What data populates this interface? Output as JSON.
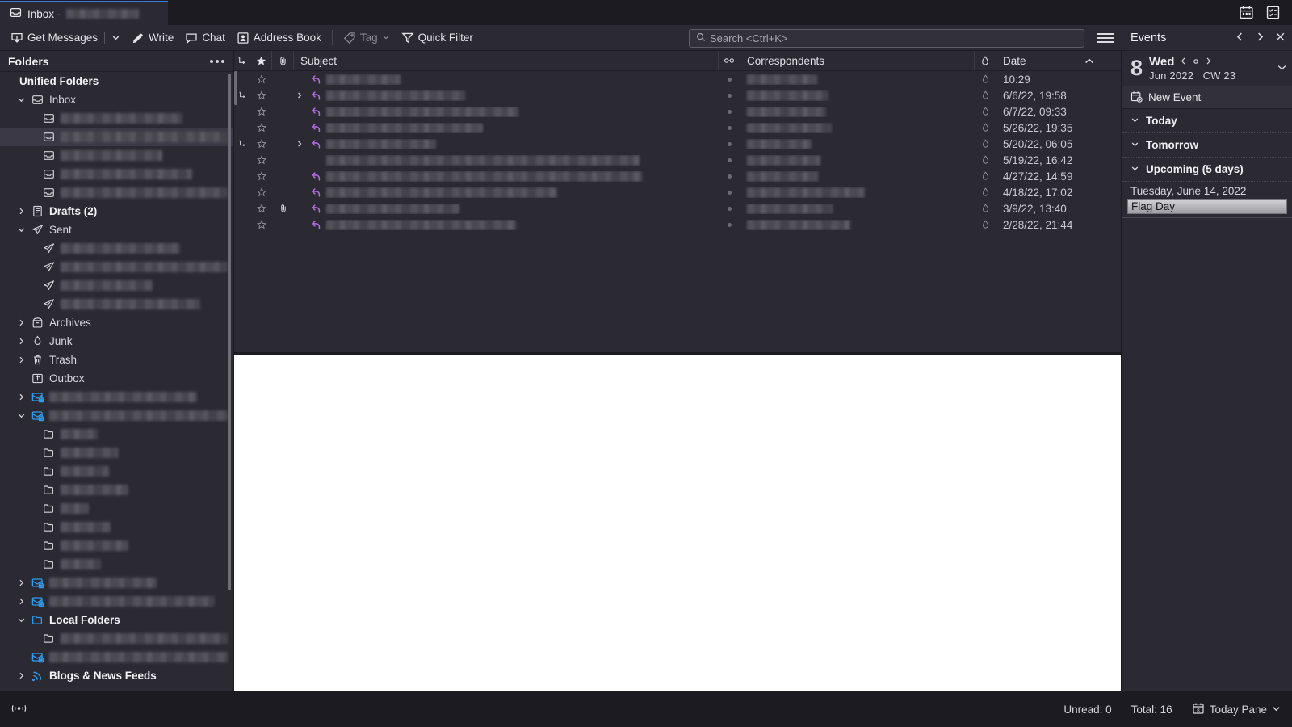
{
  "window": {
    "tab_title": "Inbox -",
    "tab_redacted_width": 90,
    "titlebar_icons": [
      "calendar-icon",
      "tasks-icon"
    ]
  },
  "toolbar": {
    "get_messages": "Get Messages",
    "write": "Write",
    "chat": "Chat",
    "address_book": "Address Book",
    "tag": "Tag",
    "quick_filter": "Quick Filter"
  },
  "search": {
    "placeholder": "Search <Ctrl+K>",
    "value": ""
  },
  "folder_pane": {
    "title": "Folders",
    "items": [
      {
        "label": "Unified Folders",
        "indent": 0,
        "twisty": "none",
        "icon": "none",
        "bold": true,
        "redacted": 0,
        "selected": false
      },
      {
        "label": "Inbox",
        "indent": 1,
        "twisty": "down",
        "icon": "inbox-icon",
        "bold": false,
        "redacted": 0,
        "selected": false
      },
      {
        "label": "",
        "indent": 2,
        "twisty": "none",
        "icon": "inbox-icon",
        "bold": false,
        "redacted": 151,
        "selected": false
      },
      {
        "label": "",
        "indent": 2,
        "twisty": "none",
        "icon": "inbox-icon",
        "bold": false,
        "redacted": 212,
        "selected": true
      },
      {
        "label": "",
        "indent": 2,
        "twisty": "none",
        "icon": "inbox-icon",
        "bold": false,
        "redacted": 126,
        "selected": false
      },
      {
        "label": "",
        "indent": 2,
        "twisty": "none",
        "icon": "inbox-icon",
        "bold": false,
        "redacted": 163,
        "selected": false
      },
      {
        "label": "",
        "indent": 2,
        "twisty": "none",
        "icon": "inbox-icon",
        "bold": false,
        "redacted": 212,
        "selected": false
      },
      {
        "label": "Drafts (2)",
        "indent": 1,
        "twisty": "right",
        "icon": "drafts-icon",
        "bold": true,
        "redacted": 0,
        "selected": false
      },
      {
        "label": "Sent",
        "indent": 1,
        "twisty": "down",
        "icon": "sent-icon",
        "bold": false,
        "redacted": 0,
        "selected": false
      },
      {
        "label": "",
        "indent": 2,
        "twisty": "none",
        "icon": "sent-icon",
        "bold": false,
        "redacted": 148,
        "selected": false
      },
      {
        "label": "",
        "indent": 2,
        "twisty": "none",
        "icon": "sent-icon",
        "bold": false,
        "redacted": 212,
        "selected": false
      },
      {
        "label": "",
        "indent": 2,
        "twisty": "none",
        "icon": "sent-icon",
        "bold": false,
        "redacted": 114,
        "selected": false
      },
      {
        "label": "",
        "indent": 2,
        "twisty": "none",
        "icon": "sent-icon",
        "bold": false,
        "redacted": 173,
        "selected": false
      },
      {
        "label": "Archives",
        "indent": 1,
        "twisty": "right",
        "icon": "archive-icon",
        "bold": false,
        "redacted": 0,
        "selected": false
      },
      {
        "label": "Junk",
        "indent": 1,
        "twisty": "right",
        "icon": "junk-icon",
        "bold": false,
        "redacted": 0,
        "selected": false
      },
      {
        "label": "Trash",
        "indent": 1,
        "twisty": "right",
        "icon": "trash-icon",
        "bold": false,
        "redacted": 0,
        "selected": false
      },
      {
        "label": "Outbox",
        "indent": 1,
        "twisty": "none",
        "icon": "outbox-icon",
        "bold": false,
        "redacted": 0,
        "selected": false
      },
      {
        "label": "",
        "indent": 1,
        "twisty": "right",
        "icon": "account-icon",
        "bold": false,
        "redacted": 183,
        "selected": false
      },
      {
        "label": "",
        "indent": 1,
        "twisty": "down",
        "icon": "account-icon",
        "bold": false,
        "redacted": 228,
        "selected": false
      },
      {
        "label": "",
        "indent": 2,
        "twisty": "none",
        "icon": "folder-icon",
        "bold": false,
        "redacted": 46,
        "selected": false
      },
      {
        "label": "",
        "indent": 2,
        "twisty": "none",
        "icon": "folder-icon",
        "bold": false,
        "redacted": 71,
        "selected": false
      },
      {
        "label": "",
        "indent": 2,
        "twisty": "none",
        "icon": "folder-icon",
        "bold": false,
        "redacted": 60,
        "selected": false
      },
      {
        "label": "",
        "indent": 2,
        "twisty": "none",
        "icon": "folder-icon",
        "bold": false,
        "redacted": 84,
        "selected": false
      },
      {
        "label": "",
        "indent": 2,
        "twisty": "none",
        "icon": "folder-icon",
        "bold": false,
        "redacted": 35,
        "selected": false
      },
      {
        "label": "",
        "indent": 2,
        "twisty": "none",
        "icon": "folder-icon",
        "bold": false,
        "redacted": 62,
        "selected": false
      },
      {
        "label": "",
        "indent": 2,
        "twisty": "none",
        "icon": "folder-icon",
        "bold": false,
        "redacted": 84,
        "selected": false
      },
      {
        "label": "",
        "indent": 2,
        "twisty": "none",
        "icon": "folder-icon",
        "bold": false,
        "redacted": 50,
        "selected": false
      },
      {
        "label": "",
        "indent": 1,
        "twisty": "right",
        "icon": "account-icon",
        "bold": false,
        "redacted": 133,
        "selected": false
      },
      {
        "label": "",
        "indent": 1,
        "twisty": "right",
        "icon": "account-icon",
        "bold": false,
        "redacted": 205,
        "selected": false
      },
      {
        "label": "Local Folders",
        "indent": 1,
        "twisty": "down",
        "icon": "localfolder-icon",
        "bold": true,
        "redacted": 0,
        "selected": false
      },
      {
        "label": "",
        "indent": 2,
        "twisty": "none",
        "icon": "folder-icon",
        "bold": false,
        "redacted": 222,
        "selected": false
      },
      {
        "label": "",
        "indent": 1,
        "twisty": "none",
        "icon": "account-icon",
        "bold": false,
        "redacted": 228,
        "selected": false
      },
      {
        "label": "Blogs & News Feeds",
        "indent": 1,
        "twisty": "right",
        "icon": "feed-icon",
        "bold": true,
        "redacted": 0,
        "selected": false
      }
    ]
  },
  "message_list": {
    "columns": [
      {
        "key": "thread",
        "label": "",
        "icon": "thread-icon"
      },
      {
        "key": "star",
        "label": "",
        "icon": "star-icon"
      },
      {
        "key": "att",
        "label": "",
        "icon": "attachment-icon"
      },
      {
        "key": "subject",
        "label": "Subject",
        "icon": ""
      },
      {
        "key": "unread",
        "label": "",
        "icon": "unread-icon"
      },
      {
        "key": "corr",
        "label": "Correspondents",
        "icon": ""
      },
      {
        "key": "spam",
        "label": "",
        "icon": "spam-icon"
      },
      {
        "key": "date",
        "label": "Date",
        "icon": "sort-asc-icon"
      },
      {
        "key": "picker",
        "label": "",
        "icon": "column-picker-icon"
      }
    ],
    "sort_column": "Date",
    "sort_direction": "asc",
    "rows": [
      {
        "thread": false,
        "starred": false,
        "attachment": false,
        "expand": false,
        "replied": true,
        "subject_width": 92,
        "unread_dot": true,
        "corr_width": 87,
        "date": "10:29"
      },
      {
        "thread": true,
        "starred": false,
        "attachment": false,
        "expand": true,
        "replied": true,
        "subject_width": 172,
        "unread_dot": true,
        "corr_width": 101,
        "date": "6/6/22, 19:58"
      },
      {
        "thread": false,
        "starred": false,
        "attachment": false,
        "expand": false,
        "replied": true,
        "subject_width": 238,
        "unread_dot": true,
        "corr_width": 98,
        "date": "6/7/22, 09:33"
      },
      {
        "thread": false,
        "starred": false,
        "attachment": false,
        "expand": false,
        "replied": true,
        "subject_width": 194,
        "unread_dot": true,
        "corr_width": 105,
        "date": "5/26/22, 19:35"
      },
      {
        "thread": true,
        "starred": false,
        "attachment": false,
        "expand": true,
        "replied": true,
        "subject_width": 136,
        "unread_dot": true,
        "corr_width": 80,
        "date": "5/20/22, 06:05"
      },
      {
        "thread": false,
        "starred": false,
        "attachment": false,
        "expand": false,
        "replied": false,
        "subject_width": 388,
        "unread_dot": true,
        "corr_width": 91,
        "date": "5/19/22, 16:42"
      },
      {
        "thread": false,
        "starred": false,
        "attachment": false,
        "expand": false,
        "replied": true,
        "subject_width": 391,
        "unread_dot": true,
        "corr_width": 88,
        "date": "4/27/22, 14:59"
      },
      {
        "thread": false,
        "starred": false,
        "attachment": false,
        "expand": false,
        "replied": true,
        "subject_width": 286,
        "unread_dot": true,
        "corr_width": 146,
        "date": "4/18/22, 17:02"
      },
      {
        "thread": false,
        "starred": false,
        "attachment": true,
        "expand": false,
        "replied": true,
        "subject_width": 165,
        "unread_dot": true,
        "corr_width": 106,
        "date": "3/9/22, 13:40"
      },
      {
        "thread": false,
        "starred": false,
        "attachment": false,
        "expand": false,
        "replied": true,
        "subject_width": 235,
        "unread_dot": true,
        "corr_width": 128,
        "date": "2/28/22, 21:44"
      }
    ]
  },
  "today_pane": {
    "title": "Events",
    "day_number": "8",
    "day_of_week": "Wed",
    "month_year": "Jun 2022",
    "calendar_week": "CW 23",
    "new_event": "New Event",
    "sections": [
      {
        "label": "Today",
        "expanded": true,
        "events": []
      },
      {
        "label": "Tomorrow",
        "expanded": true,
        "events": []
      },
      {
        "label": "Upcoming (5 days)",
        "expanded": true,
        "events": [
          {
            "date": "Tuesday, June 14, 2022",
            "title": "Flag Day"
          }
        ]
      }
    ]
  },
  "status_bar": {
    "left_icon": "feed-activity-icon",
    "unread": "Unread: 0",
    "total": "Total: 16",
    "today_pane": "Today Pane"
  },
  "colors": {
    "accent": "#3b7ddd",
    "chrome": "#2b2a33",
    "chrome_dark": "#1c1b22",
    "reply_arrow": "#b06cdb",
    "folder_blue": "#2f9ced",
    "reader_bg": "#ffffff"
  }
}
